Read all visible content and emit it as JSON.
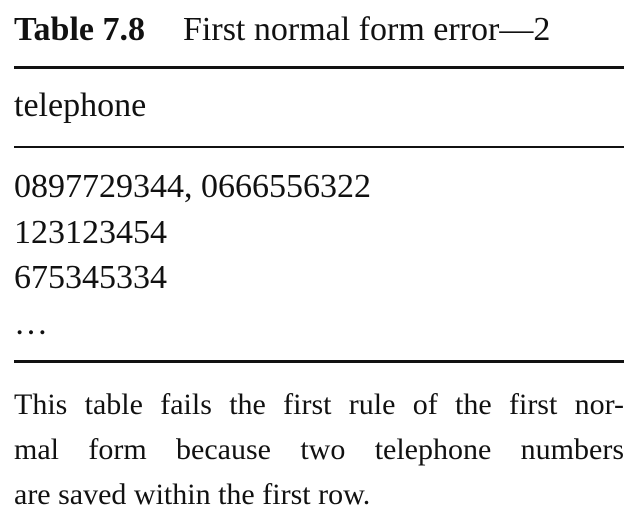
{
  "caption": {
    "label": "Table 7.8",
    "title": "First normal form error—2"
  },
  "table": {
    "header": "telephone",
    "rows": [
      "0897729344, 0666556322",
      "123123454",
      "675345334",
      "…"
    ]
  },
  "note": {
    "lines": [
      "This table fails the first rule of the first nor-",
      "mal form because two telephone numbers",
      "are saved within the first row."
    ]
  }
}
